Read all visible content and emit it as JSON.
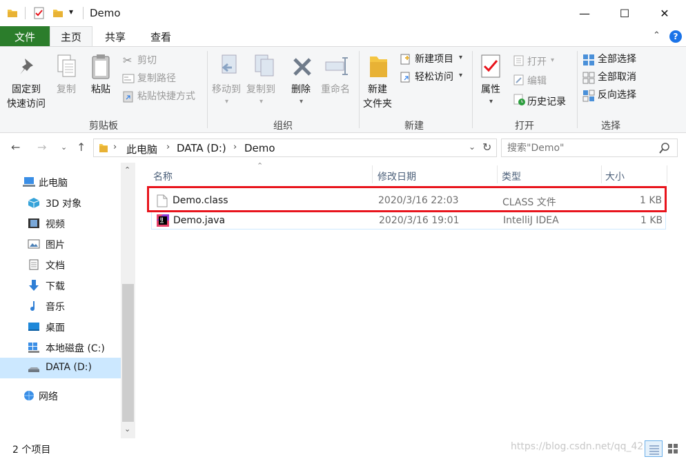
{
  "window": {
    "title": "Demo",
    "controls": {
      "minimize": "—",
      "maximize": "☐",
      "close": "✕"
    }
  },
  "ribbon_tabs": [
    "文件",
    "主页",
    "共享",
    "查看"
  ],
  "ribbon": {
    "groups": {
      "clipboard": "剪贴板",
      "organize": "组织",
      "new": "新建",
      "open": "打开",
      "select": "选择"
    },
    "pin_label_1": "固定到",
    "pin_label_2": "快速访问",
    "copy": "复制",
    "paste": "粘贴",
    "cut": "剪切",
    "copy_path": "复制路径",
    "paste_shortcut": "粘贴快捷方式",
    "move_to": "移动到",
    "copy_to": "复制到",
    "delete": "删除",
    "rename": "重命名",
    "new_folder_1": "新建",
    "new_folder_2": "文件夹",
    "new_item": "新建项目",
    "easy_access": "轻松访问",
    "properties": "属性",
    "open": "打开",
    "edit": "编辑",
    "history": "历史记录",
    "select_all": "全部选择",
    "select_none": "全部取消",
    "invert_selection": "反向选择"
  },
  "address": {
    "breadcrumb": [
      "此电脑",
      "DATA (D:)",
      "Demo"
    ]
  },
  "search": {
    "placeholder": "搜索\"Demo\""
  },
  "nav_pane": {
    "items": [
      {
        "label": "此电脑",
        "icon": "computer-icon"
      },
      {
        "label": "3D 对象",
        "icon": "cube-icon"
      },
      {
        "label": "视频",
        "icon": "video-icon"
      },
      {
        "label": "图片",
        "icon": "picture-icon"
      },
      {
        "label": "文档",
        "icon": "document-icon"
      },
      {
        "label": "下载",
        "icon": "download-icon"
      },
      {
        "label": "音乐",
        "icon": "music-icon"
      },
      {
        "label": "桌面",
        "icon": "desktop-icon"
      },
      {
        "label": "本地磁盘 (C:)",
        "icon": "windows-drive-icon"
      },
      {
        "label": "DATA (D:)",
        "icon": "drive-icon",
        "selected": true
      },
      {
        "label": "网络",
        "icon": "network-icon"
      }
    ]
  },
  "file_list": {
    "columns": [
      "名称",
      "修改日期",
      "类型",
      "大小"
    ],
    "rows": [
      {
        "name": "Demo.class",
        "modified": "2020/3/16 22:03",
        "type": "CLASS 文件",
        "size": "1 KB",
        "icon": "blank-file-icon",
        "highlighted": true
      },
      {
        "name": "Demo.java",
        "modified": "2020/3/16 19:01",
        "type": "IntelliJ IDEA",
        "size": "1 KB",
        "icon": "intellij-icon"
      }
    ]
  },
  "status": {
    "item_count": "2 个项目"
  },
  "watermark": "https://blog.csdn.net/qq_42",
  "colors": {
    "file_tab": "#2b7d2b",
    "highlight_box": "#e8141c",
    "selection": "#cce8ff",
    "folder": "#f4c542"
  }
}
